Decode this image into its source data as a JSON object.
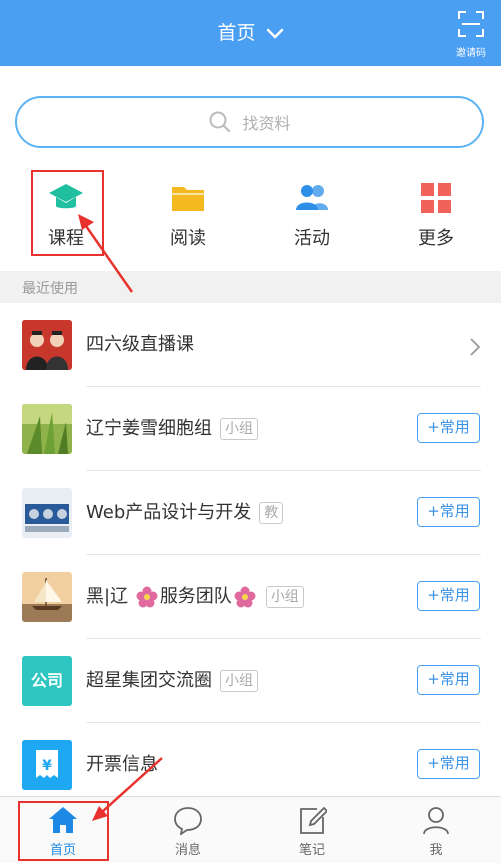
{
  "header": {
    "title": "首页",
    "invite_label": "邀请码",
    "color": "#4a9ff3"
  },
  "search": {
    "placeholder": "找资料"
  },
  "quick_nav": [
    {
      "label": "课程",
      "icon": "graduation-cap-icon",
      "color": "#1fbfa0"
    },
    {
      "label": "阅读",
      "icon": "folder-icon",
      "color": "#f5b920"
    },
    {
      "label": "活动",
      "icon": "people-icon",
      "color": "#2d8fe8"
    },
    {
      "label": "更多",
      "icon": "grid-icon",
      "color": "#f0625a"
    }
  ],
  "section_title": "最近使用",
  "list": [
    {
      "title": "四六级直播课",
      "tag": "",
      "button": ""
    },
    {
      "title": "辽宁姜雪细胞组",
      "tag": "小组",
      "button": "+常用"
    },
    {
      "title": "Web产品设计与开发",
      "tag": "教",
      "button": "+常用"
    },
    {
      "title_part1": "黑|辽",
      "title_part2": "服务团队",
      "tag": "小组",
      "button": "+常用"
    },
    {
      "title": "超星集团交流圈",
      "tag": "小组",
      "button": "+常用",
      "thumb_text": "公司"
    },
    {
      "title": "开票信息",
      "tag": "",
      "button": "+常用"
    }
  ],
  "tabs": [
    {
      "label": "首页",
      "icon": "home-icon",
      "active": true
    },
    {
      "label": "消息",
      "icon": "chat-bubble-icon",
      "active": false
    },
    {
      "label": "笔记",
      "icon": "edit-note-icon",
      "active": false
    },
    {
      "label": "我",
      "icon": "person-icon",
      "active": false
    }
  ],
  "colors": {
    "accent": "#4a9ff3",
    "annotation": "#e8322e"
  }
}
